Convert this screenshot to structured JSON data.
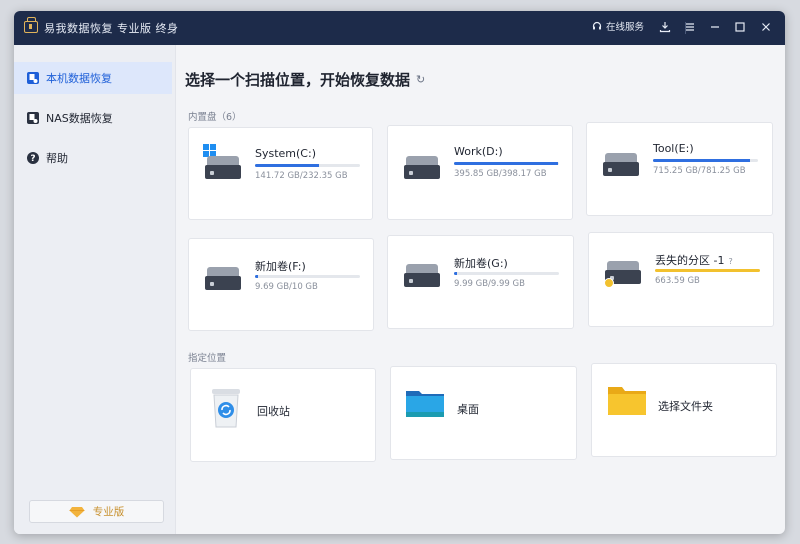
{
  "app": {
    "title": "易我数据恢复 专业版 终身",
    "service": "在线服务"
  },
  "sidebar": {
    "items": [
      {
        "label": "本机数据恢复"
      },
      {
        "label": "NAS数据恢复"
      },
      {
        "label": "帮助"
      }
    ],
    "pro_label": "专业版"
  },
  "main": {
    "title": "选择一个扫描位置，开始恢复数据",
    "internal_label": "内置盘（6）",
    "specific_label": "指定位置",
    "drives": [
      {
        "name": "System(C:)",
        "size": "141.72 GB/232.35 GB",
        "usage": 0.61
      },
      {
        "name": "Work(D:)",
        "size": "395.85 GB/398.17 GB",
        "usage": 0.99
      },
      {
        "name": "Tool(E:)",
        "size": "715.25 GB/781.25 GB",
        "usage": 0.92
      },
      {
        "name": "新加卷(F:)",
        "size": "9.69 GB/10 GB",
        "usage": 0.03
      },
      {
        "name": "新加卷(G:)",
        "size": "9.99 GB/9.99 GB",
        "usage": 0.03
      },
      {
        "name": "丢失的分区 -1",
        "size": "663.59 GB",
        "usage": 1.0,
        "help": "?"
      }
    ],
    "locations": [
      {
        "label": "回收站"
      },
      {
        "label": "桌面"
      },
      {
        "label": "选择文件夹"
      }
    ]
  },
  "colors": {
    "accent": "#2f6fe0",
    "titlebar": "#1d2b4a",
    "lost_partition": "#f2c12e",
    "pro": "#c8912f"
  }
}
